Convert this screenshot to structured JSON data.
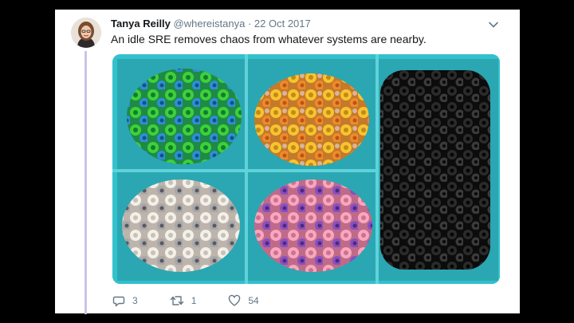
{
  "tweet": {
    "author_name": "Tanya Reilly",
    "handle": "@whereistanya",
    "separator": "·",
    "date": "22 Oct 2017",
    "text": "An idle SRE removes chaos from whatever systems are nearby."
  },
  "media": {
    "compartments": [
      "green-blue beads",
      "yellow-orange beads",
      "black beads",
      "white-silver beads",
      "pink-purple beads"
    ]
  },
  "actions": {
    "reply_count": "3",
    "retweet_count": "1",
    "like_count": "54"
  },
  "icons": {
    "reply": "reply-icon",
    "retweet": "retweet-icon",
    "like": "heart-icon",
    "menu": "chevron-down-icon"
  },
  "colors": {
    "accent_line": "#c9c3ea",
    "text_muted": "#657786",
    "text_main": "#14171a"
  }
}
